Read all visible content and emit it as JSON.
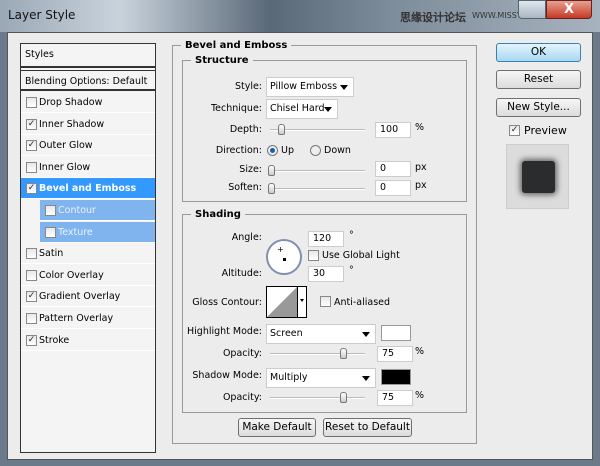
{
  "window": {
    "title": "Layer Style",
    "watermark": "思缘设计论坛",
    "watermark_url": "WWW.MISSYUAN.COM",
    "close_glyph": "X"
  },
  "styles_list": {
    "header": "Styles",
    "blending": "Blending Options: Default",
    "items": [
      {
        "label": "Drop Shadow",
        "checked": false
      },
      {
        "label": "Inner Shadow",
        "checked": true
      },
      {
        "label": "Outer Glow",
        "checked": true
      },
      {
        "label": "Inner Glow",
        "checked": false
      },
      {
        "label": "Bevel and Emboss",
        "checked": true,
        "selected": true
      },
      {
        "label": "Contour",
        "checked": false,
        "sub": true
      },
      {
        "label": "Texture",
        "checked": false,
        "sub": true
      },
      {
        "label": "Satin",
        "checked": false
      },
      {
        "label": "Color Overlay",
        "checked": false
      },
      {
        "label": "Gradient Overlay",
        "checked": true
      },
      {
        "label": "Pattern Overlay",
        "checked": false
      },
      {
        "label": "Stroke",
        "checked": true
      }
    ]
  },
  "bevel": {
    "title": "Bevel and Emboss",
    "structure": {
      "title": "Structure",
      "style_label": "Style:",
      "style_value": "Pillow Emboss",
      "technique_label": "Technique:",
      "technique_value": "Chisel Hard",
      "depth_label": "Depth:",
      "depth_value": "100",
      "depth_unit": "%",
      "depth_slider_pct": 10,
      "direction_label": "Direction:",
      "dir_up": "Up",
      "dir_down": "Down",
      "size_label": "Size:",
      "size_value": "0",
      "size_unit": "px",
      "soften_label": "Soften:",
      "soften_value": "0",
      "soften_unit": "px"
    },
    "shading": {
      "title": "Shading",
      "angle_label": "Angle:",
      "angle_value": "120",
      "degree": "°",
      "global_light": "Use Global Light",
      "altitude_label": "Altitude:",
      "altitude_value": "30",
      "gloss_label": "Gloss Contour:",
      "anti_aliased": "Anti-aliased",
      "highlight_label": "Highlight Mode:",
      "highlight_value": "Screen",
      "highlight_color": "#ffffff",
      "hl_opacity_label": "Opacity:",
      "hl_opacity_value": "75",
      "pct": "%",
      "shadow_label": "Shadow Mode:",
      "shadow_value": "Multiply",
      "shadow_color": "#000000",
      "sh_opacity_label": "Opacity:",
      "sh_opacity_value": "75"
    },
    "make_default": "Make Default",
    "reset_default": "Reset to Default"
  },
  "actions": {
    "ok": "OK",
    "reset": "Reset",
    "new_style": "New Style...",
    "preview": "Preview",
    "preview_checked": true
  }
}
